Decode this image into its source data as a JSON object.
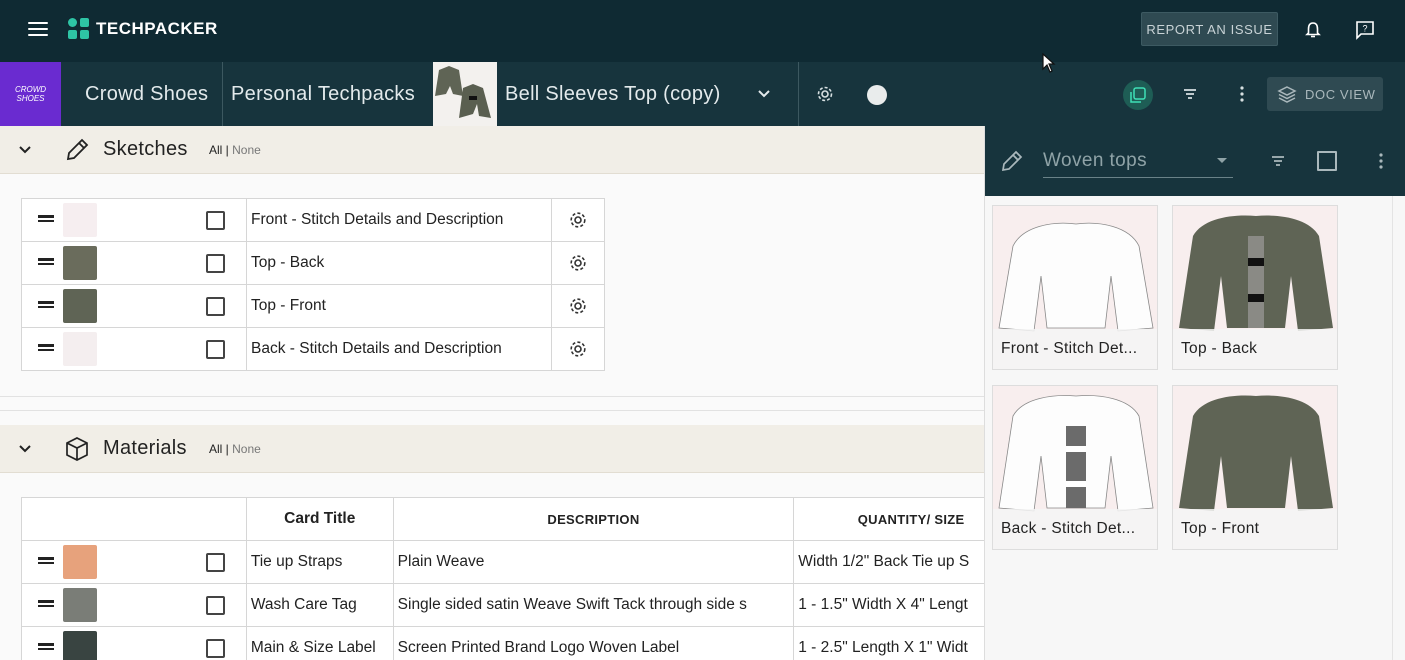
{
  "app": {
    "name": "TECHPACKER"
  },
  "topbar": {
    "report_label": "REPORT AN ISSUE",
    "bell_icon": "bell-icon",
    "help_icon": "help-chat-icon"
  },
  "navbar": {
    "brand_thumb_text": "CROWD SHOES",
    "crumbs": [
      "Crowd Shoes",
      "Personal Techpacks",
      "Bell Sleeves Top (copy)"
    ],
    "doc_view_label": "DOC VIEW"
  },
  "sketches": {
    "title": "Sketches",
    "all_label": "All |",
    "none_label": "None",
    "rows": [
      {
        "title": "Front - Stitch Details and Description",
        "thumb_color": "#f6eef0"
      },
      {
        "title": "Top - Back",
        "thumb_color": "#6a6c5c"
      },
      {
        "title": "Top - Front",
        "thumb_color": "#5f6455"
      },
      {
        "title": "Back - Stitch Details and Description",
        "thumb_color": "#f4eeef"
      }
    ]
  },
  "materials": {
    "title": "Materials",
    "all_label": "All |",
    "none_label": "None",
    "columns": [
      "Card Title",
      "DESCRIPTION",
      "QUANTITY/ SIZE"
    ],
    "rows": [
      {
        "title": "Tie up Straps",
        "description": "Plain Weave",
        "quantity": "Width 1/2\" Back Tie up S",
        "thumb_color": "#e7a27c"
      },
      {
        "title": "Wash Care Tag",
        "description": "Single sided satin Weave Swift Tack through side s",
        "quantity": "1 - 1.5\" Width X 4\" Lengt",
        "thumb_color": "#7a7d77"
      },
      {
        "title": "Main & Size Label",
        "description": "Screen Printed Brand Logo Woven Label",
        "quantity": "1 - 2.5\" Length X 1\" Widt",
        "thumb_color": "#394441"
      }
    ]
  },
  "panel": {
    "select_value": "Woven tops",
    "cards": [
      {
        "label": "Front - Stitch Det...",
        "style": "white"
      },
      {
        "label": "Top - Back",
        "style": "olive-back"
      },
      {
        "label": "Back - Stitch Det...",
        "style": "white-back"
      },
      {
        "label": "Top - Front",
        "style": "olive"
      }
    ]
  },
  "colors": {
    "dark_header": "#0f2a33",
    "nav_bg": "#17343d",
    "accent": "#2ec4a5",
    "brand_purple": "#6a2bd0"
  }
}
